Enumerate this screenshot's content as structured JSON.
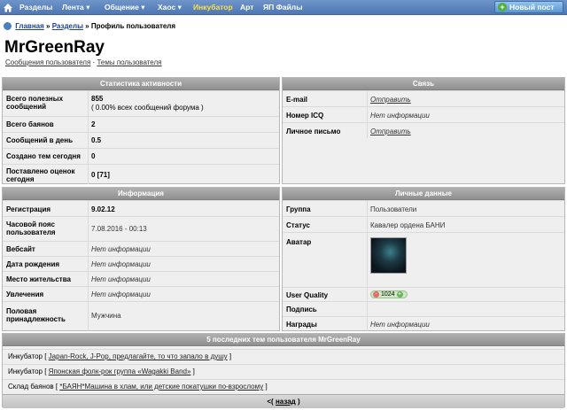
{
  "nav": {
    "items": [
      {
        "label": "Разделы",
        "arrow": false
      },
      {
        "label": "Лента ▾",
        "arrow": true
      },
      {
        "label": "Общение ▾",
        "arrow": true
      },
      {
        "label": "Хаос ▾",
        "arrow": true
      },
      {
        "label": "Инкубатор",
        "active": true
      },
      {
        "label": "Арт"
      },
      {
        "label": "ЯП Файлы"
      }
    ],
    "new_post_label": "Новый пост",
    "accent_color": "#ffe040"
  },
  "breadcrumb": {
    "home": "Главная",
    "sections": "Разделы",
    "current": "Профиль пользователя",
    "sep": "»"
  },
  "profile": {
    "username": "MrGreenRay",
    "links": {
      "posts": "Сообщения пользователя",
      "sep": "·",
      "topics": "Темы пользователя"
    }
  },
  "activity": {
    "title": "Статистика активности",
    "rows": [
      {
        "label": "Всего полезных сообщений",
        "value": "855",
        "sub": "( 0.00% всех сообщений форума )"
      },
      {
        "label": "Всего баянов",
        "value": "2"
      },
      {
        "label": "Сообщений в день",
        "value": "0.5"
      },
      {
        "label": "Создано тем сегодня",
        "value": "0"
      },
      {
        "label": "Поставлено оценок сегодня",
        "value": "0 [71]"
      }
    ]
  },
  "contact": {
    "title": "Связь",
    "rows": [
      {
        "label": "E-mail",
        "value": "Отправить"
      },
      {
        "label": "Номер ICQ",
        "value": "Нет информации"
      },
      {
        "label": "Личное письмо",
        "value": "Отправить"
      }
    ]
  },
  "info": {
    "title": "Информация",
    "rows": [
      {
        "label": "Регистрация",
        "value": "9.02.12"
      },
      {
        "label": "Часовой пояс пользователя",
        "value": "7.08.2016 - 00:13"
      },
      {
        "label": "Вебсайт",
        "value": "Нет информации"
      },
      {
        "label": "Дата рождения",
        "value": "Нет информации"
      },
      {
        "label": "Место жительства",
        "value": "Нет информации"
      },
      {
        "label": "Увлечения",
        "value": "Нет информации"
      },
      {
        "label": "Половая принадлежность",
        "value": "Мужчина"
      }
    ]
  },
  "personal": {
    "title": "Личные данные",
    "rows": [
      {
        "label": "Группа",
        "value": "Пользователи"
      },
      {
        "label": "Статус",
        "value": "Кавалер ордена БАНИ"
      },
      {
        "label": "Аватар",
        "value": ""
      },
      {
        "label": "User Quality",
        "value": "1024",
        "minus": "-",
        "plus": "+"
      },
      {
        "label": "Подпись",
        "value": ""
      },
      {
        "label": "Награды",
        "value": "Нет информации"
      }
    ]
  },
  "last_topics": {
    "title": "5 последних тем пользователя MrGreenRay",
    "items": [
      {
        "section": "Инкубатор",
        "open": " [ ",
        "topic": "Japan-Rock, J-Pop, предлагайте, то что запало в душу",
        "close": " ]"
      },
      {
        "section": "Инкубатор",
        "open": " [ ",
        "topic": "Японская фолк-рок группа «Wagakki Band»",
        "close": " ]"
      },
      {
        "section": "Склад баянов",
        "open": " [ ",
        "topic": "*БАЯН*Машина в хлам, или детские покатушки по-взрослому",
        "close": " ]"
      }
    ],
    "back_prefix": "<( ",
    "back_label": "назад",
    "back_suffix": " )"
  }
}
